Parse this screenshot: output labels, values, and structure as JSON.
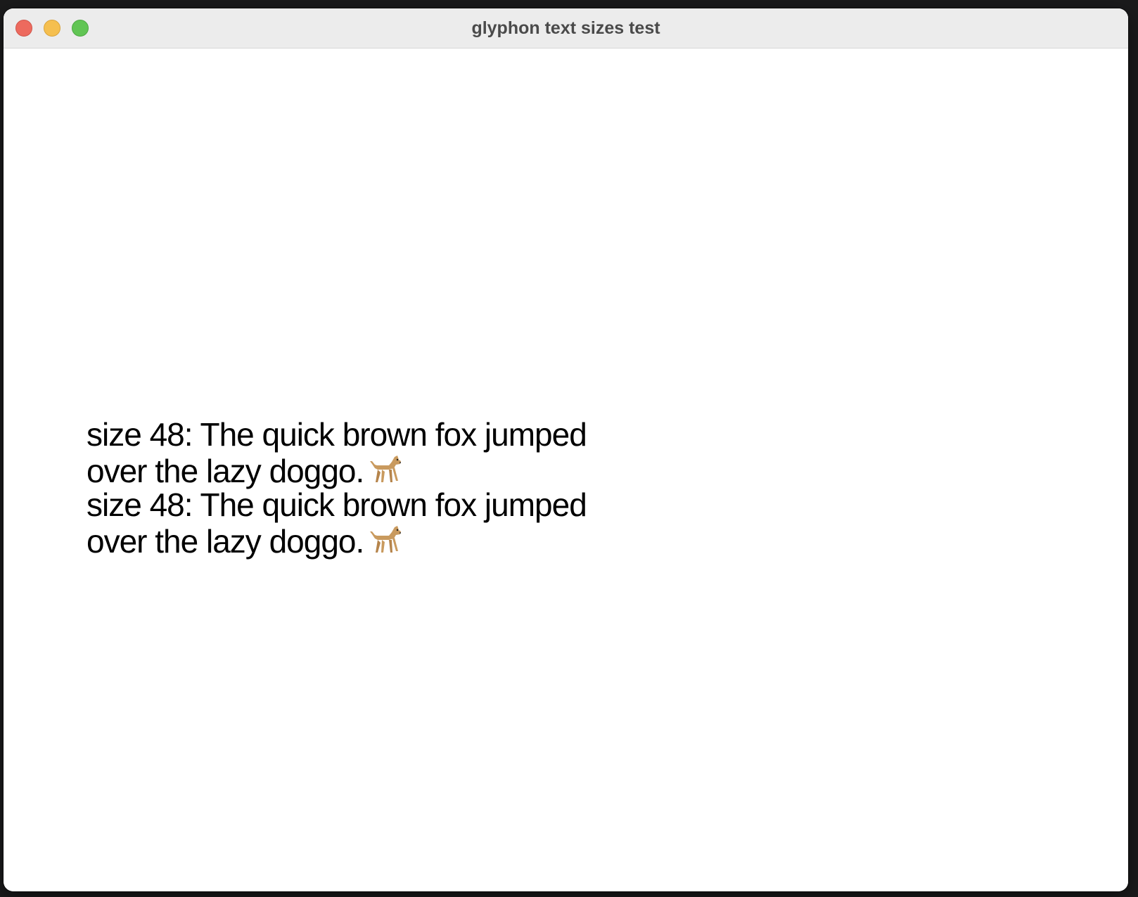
{
  "window": {
    "title": "glyphon text sizes test"
  },
  "content": {
    "lines": [
      {
        "text": "size 48: The quick brown fox jumped over the lazy doggo.",
        "icon": "dog-icon"
      },
      {
        "text": "size 48: The quick brown fox jumped over the lazy doggo.",
        "icon": "dog-icon"
      }
    ]
  },
  "colors": {
    "close": "#ed6a5e",
    "minimize": "#f5bf4f",
    "maximize": "#61c554",
    "titlebar": "#ececec",
    "canvas": "#ffffff",
    "text": "#000000"
  }
}
